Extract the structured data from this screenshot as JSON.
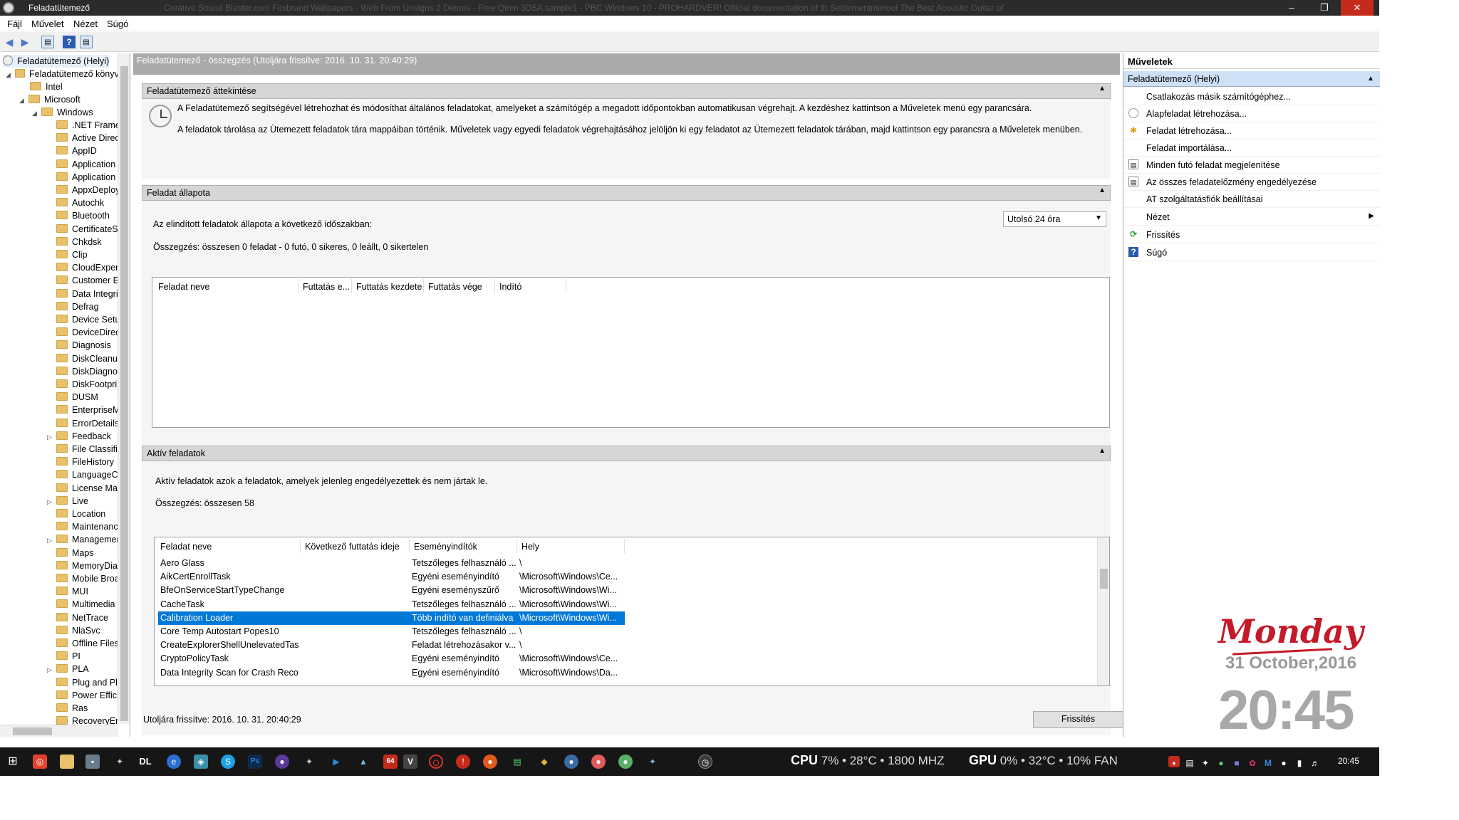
{
  "window": {
    "title": "Feladatütemező",
    "ghost_tabs": "Creative Sound Blaster.com     Foxbrand Wallpapers - Web     From Unsigns 2 Demos - Free     Qinm 3DSA sample1 - PBC     Windows 10 - PROHARDVER!     Official documentation of th     Settlementmixtool     The Best Acoustic Guitar of"
  },
  "menu": [
    "Fájl",
    "Művelet",
    "Nézet",
    "Súgó"
  ],
  "tree": {
    "root": "Feladatütemező (Helyi)",
    "library": "Feladatütemező könyvtára",
    "intel": "Intel",
    "microsoft": "Microsoft",
    "windows": "Windows",
    "folders": [
      ".NET Framework",
      "Active Directory",
      "AppID",
      "Application Experience",
      "Application Data",
      "AppxDeployment",
      "Autochk",
      "Bluetooth",
      "CertificateServices",
      "Chkdsk",
      "Clip",
      "CloudExperienceHost",
      "Customer Experience",
      "Data Integrity",
      "Defrag",
      "Device Setup",
      "DeviceDirectory",
      "Diagnosis",
      "DiskCleanup",
      "DiskDiagnostic",
      "DiskFootprint",
      "DUSM",
      "EnterpriseMgmt",
      "ErrorDetails",
      "Feedback",
      "File Classification",
      "FileHistory",
      "LanguageComponents",
      "License Manager",
      "Live",
      "Location",
      "Maintenance",
      "Management",
      "Maps",
      "MemoryDiagnostic",
      "Mobile Broadband",
      "MUI",
      "Multimedia",
      "NetTrace",
      "NlaSvc",
      "Offline Files",
      "PI",
      "PLA",
      "Plug and Play",
      "Power Efficiency",
      "Ras",
      "RecoveryEnvironment"
    ]
  },
  "center": {
    "header": "Feladatütemező - összegzés (Utoljára frissítve: 2016. 10. 31. 20:40:29)",
    "overview": {
      "title": "Feladatütemező áttekintése",
      "text1": "A Feladatütemező segítségével létrehozhat és módosíthat általános feladatokat, amelyeket a számítógép a megadott időpontokban automatikusan végrehajt. A kezdéshez kattintson a Műveletek menü egy parancsára.",
      "text2": "A feladatok tárolása az Ütemezett feladatok tára mappáiban történik. Műveletek vagy egyedi feladatok végrehajtásához jelöljön ki egy feladatot az Ütemezett feladatok tárában, majd kattintson egy parancsra a Műveletek menüben."
    },
    "status": {
      "title": "Feladat állapota",
      "label": "Az elindított feladatok állapota a következő időszakban:",
      "dropdown": "Utolsó 24 óra",
      "summary": "Összegzés: összesen 0 feladat - 0 futó, 0 sikeres, 0 leállt, 0 sikertelen",
      "columns": [
        "Feladat neve",
        "Futtatás e...",
        "Futtatás kezdete",
        "Futtatás vége",
        "Indító"
      ]
    },
    "active": {
      "title": "Aktív feladatok",
      "desc": "Aktív feladatok azok a feladatok, amelyek jelenleg engedélyezettek és nem jártak le.",
      "summary": "Összegzés: összesen 58",
      "columns": [
        "Feladat neve",
        "Következő futtatás ideje",
        "Eseményindítók",
        "Hely"
      ],
      "rows": [
        {
          "name": "Aero Glass",
          "next": "",
          "trigger": "Tetszőleges felhasználó ...",
          "loc": "\\"
        },
        {
          "name": "AikCertEnrollTask",
          "next": "",
          "trigger": "Egyéni eseményindító",
          "loc": "\\Microsoft\\Windows\\Ce..."
        },
        {
          "name": "BfeOnServiceStartTypeChange",
          "next": "",
          "trigger": "Egyéni eseményszűrő",
          "loc": "\\Microsoft\\Windows\\Wi..."
        },
        {
          "name": "CacheTask",
          "next": "",
          "trigger": "Tetszőleges felhasználó ...",
          "loc": "\\Microsoft\\Windows\\Wi..."
        },
        {
          "name": "Calibration Loader",
          "next": "",
          "trigger": "Több indító van definiálva",
          "loc": "\\Microsoft\\Windows\\Wi..."
        },
        {
          "name": "Core Temp Autostart Popes10",
          "next": "",
          "trigger": "Tetszőleges felhasználó ...",
          "loc": "\\"
        },
        {
          "name": "CreateExplorerShellUnelevatedTask",
          "next": "",
          "trigger": "Feladat létrehozásakor v...",
          "loc": "\\"
        },
        {
          "name": "CryptoPolicyTask",
          "next": "",
          "trigger": "Egyéni eseményindító",
          "loc": "\\Microsoft\\Windows\\Ce..."
        },
        {
          "name": "Data Integrity Scan for Crash Reco...",
          "next": "",
          "trigger": "Egyéni eseményindító",
          "loc": "\\Microsoft\\Windows\\Da..."
        }
      ]
    },
    "footer": {
      "text": "Utoljára frissítve: 2016. 10. 31. 20:40:29",
      "refresh": "Frissítés"
    }
  },
  "actions": {
    "title": "Műveletek",
    "sub": "Feladatütemező (Helyi)",
    "items": [
      "Csatlakozás másik számítógéphez...",
      "Alapfeladat létrehozása...",
      "Feladat létrehozása...",
      "Feladat importálása...",
      "Minden futó feladat megjelenítése",
      "Az összes feladatelőzmény engedélyezése",
      "AT szolgáltatásfiók beállításai",
      "Nézet",
      "Frissítés",
      "Súgó"
    ]
  },
  "widget": {
    "day": "Monday",
    "date": "31 October,2016",
    "time": "20:45"
  },
  "taskbar": {
    "cpu_label": "CPU",
    "cpu_stats": "7% • 28°C • 1800 MHZ",
    "gpu_label": "GPU",
    "gpu_stats": "0% • 32°C • 10% FAN",
    "clock": "20:45",
    "badge_dl": "DL",
    "badge_64": "64"
  }
}
